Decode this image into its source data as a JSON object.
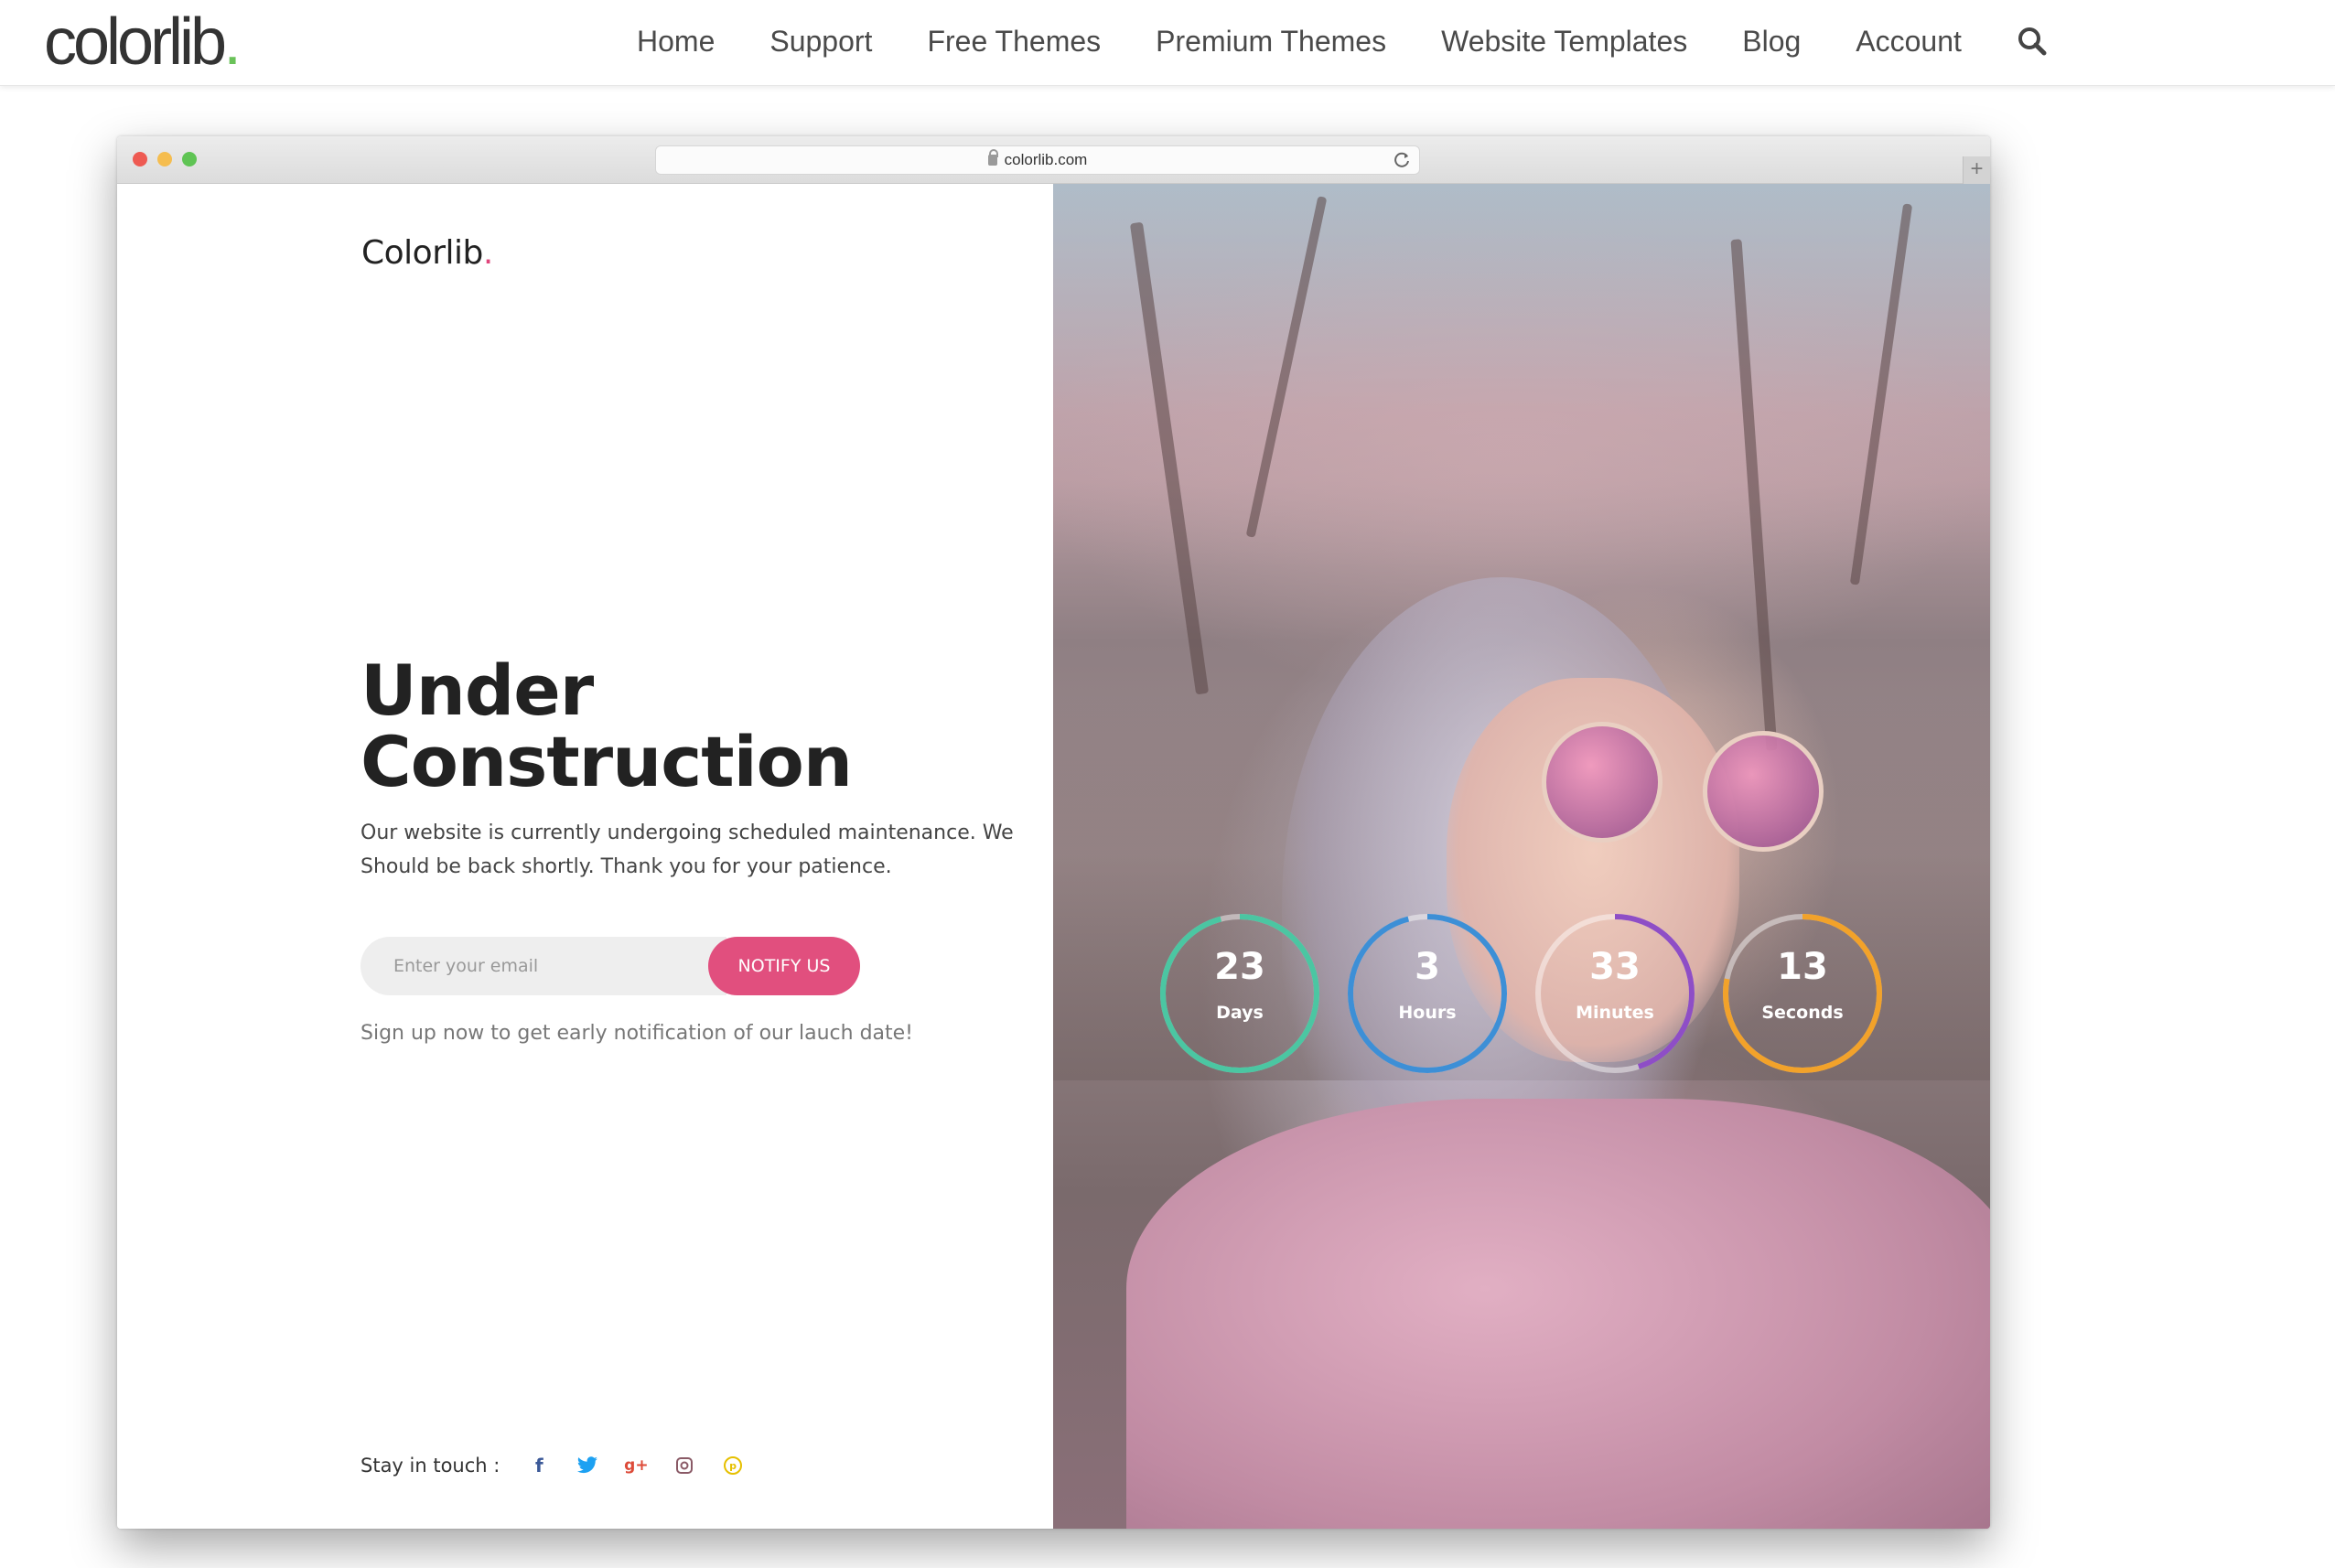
{
  "site_header": {
    "logo_text": "colorlib",
    "logo_dot": ".",
    "nav": [
      "Home",
      "Support",
      "Free Themes",
      "Premium Themes",
      "Website Templates",
      "Blog",
      "Account"
    ],
    "search_icon": "search-icon"
  },
  "browser": {
    "url": "colorlib.com",
    "new_tab": "+"
  },
  "page": {
    "brand": "Colorlib",
    "brand_dot": ".",
    "headline_line1": "Under",
    "headline_line2": "Construction",
    "description": "Our website is currently undergoing scheduled maintenance. We Should be back shortly. Thank you for your patience.",
    "email_placeholder": "Enter your email",
    "notify_button": "NOTIFY US",
    "signup_note": "Sign up now to get early notification of our lauch date!",
    "stay_in_touch": "Stay in touch :",
    "social": [
      {
        "icon": "facebook-icon",
        "glyph": "f",
        "color": "#3b5998"
      },
      {
        "icon": "twitter-icon",
        "glyph": "🐦",
        "color": "#1da1f2"
      },
      {
        "icon": "google-plus-icon",
        "glyph": "g+",
        "color": "#dd4b39"
      },
      {
        "icon": "instagram-icon",
        "glyph": "◙",
        "color": "#8a3ab9"
      },
      {
        "icon": "pinterest-icon",
        "glyph": "℗",
        "color": "#e6c000"
      }
    ]
  },
  "countdown": [
    {
      "value": "23",
      "label": "Days",
      "color": "#4bc6a2",
      "progress": 0.96
    },
    {
      "value": "3",
      "label": "Hours",
      "color": "#3d8fd6",
      "progress": 0.96
    },
    {
      "value": "33",
      "label": "Minutes",
      "color": "#8e4ec6",
      "progress": 0.45
    },
    {
      "value": "13",
      "label": "Seconds",
      "color": "#f2a22a",
      "progress": 0.78
    }
  ],
  "colors": {
    "accent": "#e14f7e",
    "logo_green": "#6ac259"
  }
}
